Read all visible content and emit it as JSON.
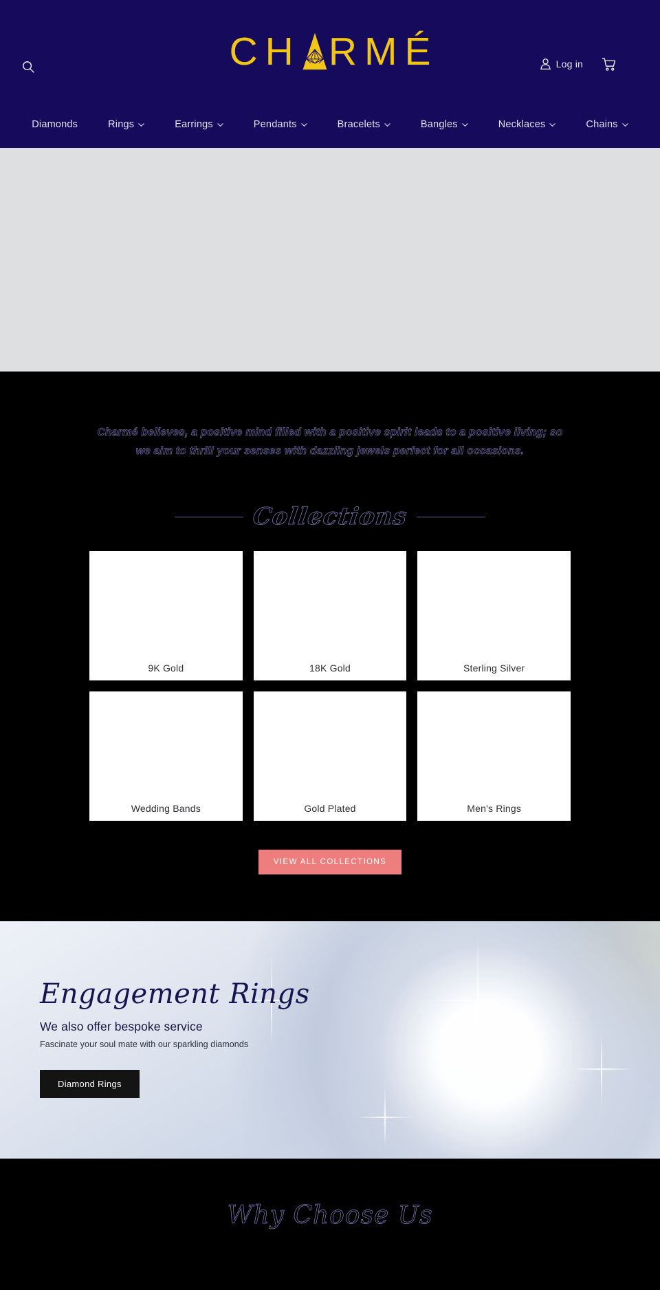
{
  "brand": {
    "logo_text": "CHARMÉ",
    "logo_color": "#f2c617",
    "header_bg": "#150a5c"
  },
  "header": {
    "search_icon": "search-icon",
    "account": {
      "icon": "user-icon",
      "label": "Log in"
    },
    "cart": {
      "icon": "cart-icon"
    },
    "nav": [
      {
        "label": "Diamonds",
        "has_dropdown": false
      },
      {
        "label": "Rings",
        "has_dropdown": true
      },
      {
        "label": "Earrings",
        "has_dropdown": true
      },
      {
        "label": "Pendants",
        "has_dropdown": true
      },
      {
        "label": "Bracelets",
        "has_dropdown": true
      },
      {
        "label": "Bangles",
        "has_dropdown": true
      },
      {
        "label": "Necklaces",
        "has_dropdown": true
      },
      {
        "label": "Chains",
        "has_dropdown": true
      }
    ]
  },
  "tagline": {
    "text": "Charmé believes, a positive mind filled with a positive spirit leads to a positive living; so we aim to thrill your senses with dazzling jewels perfect for all occasions."
  },
  "collections": {
    "title": "Collections",
    "items": [
      {
        "label": "9K Gold"
      },
      {
        "label": "18K Gold"
      },
      {
        "label": "Sterling Silver"
      },
      {
        "label": "Wedding Bands"
      },
      {
        "label": "Gold Plated"
      },
      {
        "label": "Men's Rings"
      }
    ],
    "view_all_label": "VIEW ALL COLLECTIONS",
    "view_all_color": "#ee7d7d"
  },
  "engagement": {
    "title": "Engagement Rings",
    "subtitle": "We also offer bespoke service",
    "description": "Fascinate your soul mate with our sparkling diamonds",
    "button_label": "Diamond Rings"
  },
  "why_choose": {
    "title": "Why Choose Us"
  }
}
